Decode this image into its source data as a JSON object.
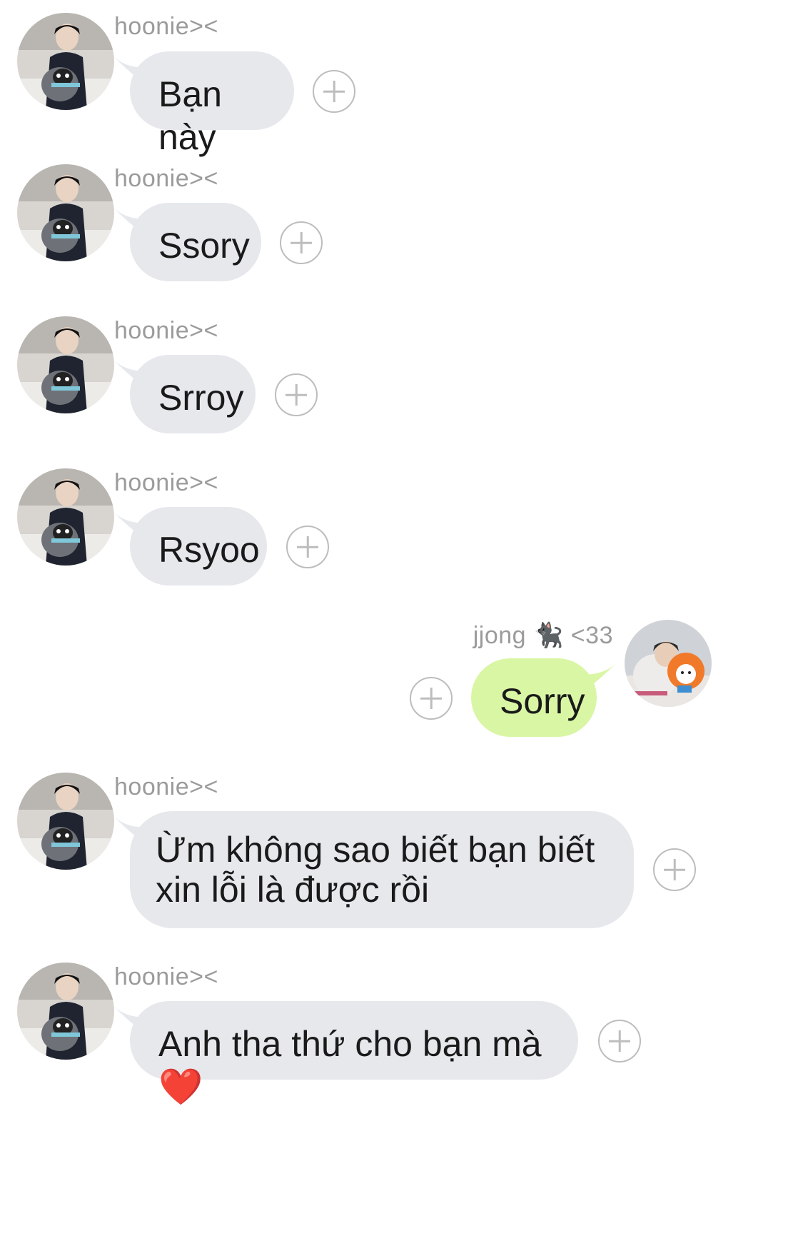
{
  "colors": {
    "incoming_bubble": "#e6e8ec",
    "outgoing_bubble": "#d9f6a5",
    "sender_name": "#9b9b9b",
    "add_reaction_icon": "#bdbdbd"
  },
  "messages": [
    {
      "direction": "incoming",
      "sender": "hoonie><",
      "text": "Bạn này",
      "avatar": "avatar-penguin-plush-photo"
    },
    {
      "direction": "incoming",
      "sender": "hoonie><",
      "text": "Ssory",
      "avatar": "avatar-penguin-plush-photo"
    },
    {
      "direction": "incoming",
      "sender": "hoonie><",
      "text": "Srroy",
      "avatar": "avatar-penguin-plush-photo"
    },
    {
      "direction": "incoming",
      "sender": "hoonie><",
      "text": "Rsyoo",
      "avatar": "avatar-penguin-plush-photo"
    },
    {
      "direction": "outgoing",
      "sender": "jjong 🐈‍⬛ <33",
      "text": "Sorry",
      "avatar": "avatar-orange-plush-photo"
    },
    {
      "direction": "incoming",
      "sender": "hoonie><",
      "text": "Ừm không sao biết bạn biết xin lỗi là được rồi",
      "avatar": "avatar-penguin-plush-photo"
    },
    {
      "direction": "incoming",
      "sender": "hoonie><",
      "text": "Anh tha thứ cho bạn mà ❤️",
      "avatar": "avatar-penguin-plush-photo"
    }
  ]
}
